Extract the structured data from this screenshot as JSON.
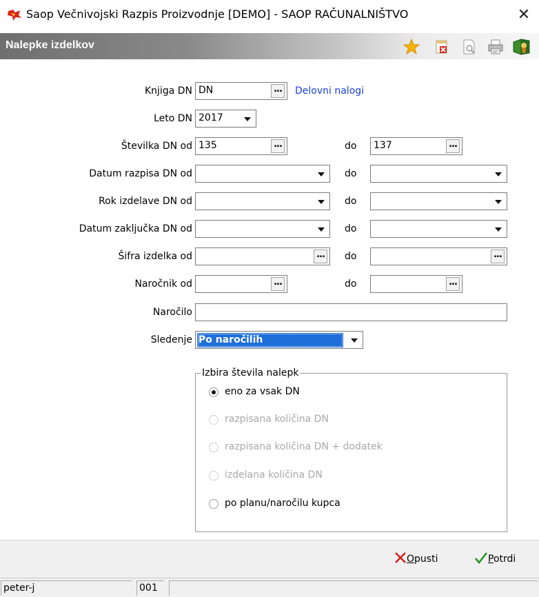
{
  "window": {
    "title": "Saop  Večnivojski Razpis Proizvodnje [DEMO] - SAOP RAČUNALNIŠTVO",
    "close": "✕"
  },
  "header": {
    "title": "Nalepke izdelkov",
    "icons": [
      "star-icon",
      "delete-icon",
      "preview-icon",
      "print-icon",
      "exit-icon"
    ]
  },
  "form": {
    "knjiga_label": "Knjiga DN",
    "knjiga_value": "DN",
    "knjiga_link": "Delovni nalogi",
    "leto_label": "Leto DN",
    "leto_value": "2017",
    "stevilka_label": "Številka DN od",
    "stevilka_from": "135",
    "stevilka_to": "137",
    "datum_razpisa_label": "Datum razpisa DN od",
    "rok_label": "Rok izdelave DN od",
    "datum_zakljucka_label": "Datum zaključka DN od",
    "sifra_label": "Šifra izdelka od",
    "narocnik_label": "Naročnik od",
    "narocilo_label": "Naročilo",
    "sledenje_label": "Sledenje",
    "sledenje_value": "Po naročilih",
    "do_label": "do",
    "dots": "..."
  },
  "group": {
    "legend": "Izbira števila nalepk",
    "options": [
      {
        "label": "eno za vsak DN",
        "checked": true,
        "disabled": false
      },
      {
        "label": "razpisana količina DN",
        "checked": false,
        "disabled": true
      },
      {
        "label": "razpisana količina DN + dodatek",
        "checked": false,
        "disabled": true
      },
      {
        "label": "izdelana količina DN",
        "checked": false,
        "disabled": true
      },
      {
        "label": "po planu/naročilu kupca",
        "checked": false,
        "disabled": false
      }
    ]
  },
  "actions": {
    "cancel_u": "O",
    "cancel_rest": "pusti",
    "confirm_u": "P",
    "confirm_rest": "otrdi"
  },
  "status": {
    "user": "peter-j",
    "code": "001"
  },
  "colors": {
    "link": "#1a3fe0",
    "selection": "#1e6fd9",
    "cancel_x": "#d0201a",
    "confirm_check": "#1d8f1d"
  }
}
